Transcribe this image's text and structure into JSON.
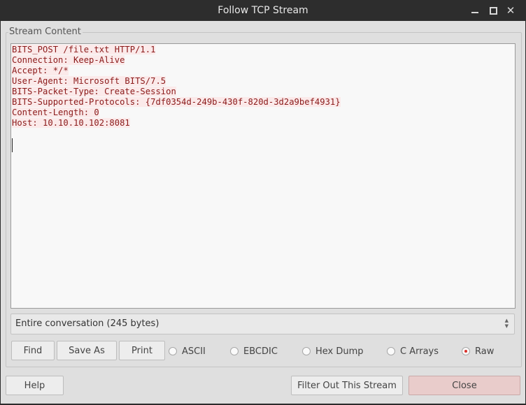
{
  "window": {
    "title": "Follow TCP Stream",
    "controls": {
      "minimize": "minimize-icon",
      "maximize": "maximize-icon",
      "close": "close-icon"
    }
  },
  "stream": {
    "group_label": "Stream Content",
    "lines": [
      "BITS_POST /file.txt HTTP/1.1",
      "Connection: Keep-Alive",
      "Accept: */*",
      "User-Agent: Microsoft BITS/7.5",
      "BITS-Packet-Type: Create-Session",
      "BITS-Supported-Protocols: {7df0354d-249b-430f-820d-3d2a9bef4931}",
      "Content-Length: 0",
      "Host: 10.10.10.102:8081"
    ],
    "text_color": "#8b1a1a",
    "highlight_color": "#fbeaea"
  },
  "conversation_select": {
    "value": "Entire conversation (245 bytes)"
  },
  "toolbar": {
    "find": "Find",
    "save_as": "Save As",
    "print": "Print"
  },
  "format": {
    "options": [
      {
        "label": "ASCII",
        "selected": false
      },
      {
        "label": "EBCDIC",
        "selected": false
      },
      {
        "label": "Hex Dump",
        "selected": false
      },
      {
        "label": "C Arrays",
        "selected": false
      },
      {
        "label": "Raw",
        "selected": true
      }
    ]
  },
  "footer": {
    "help": "Help",
    "filter_out": "Filter Out This Stream",
    "close": "Close"
  }
}
